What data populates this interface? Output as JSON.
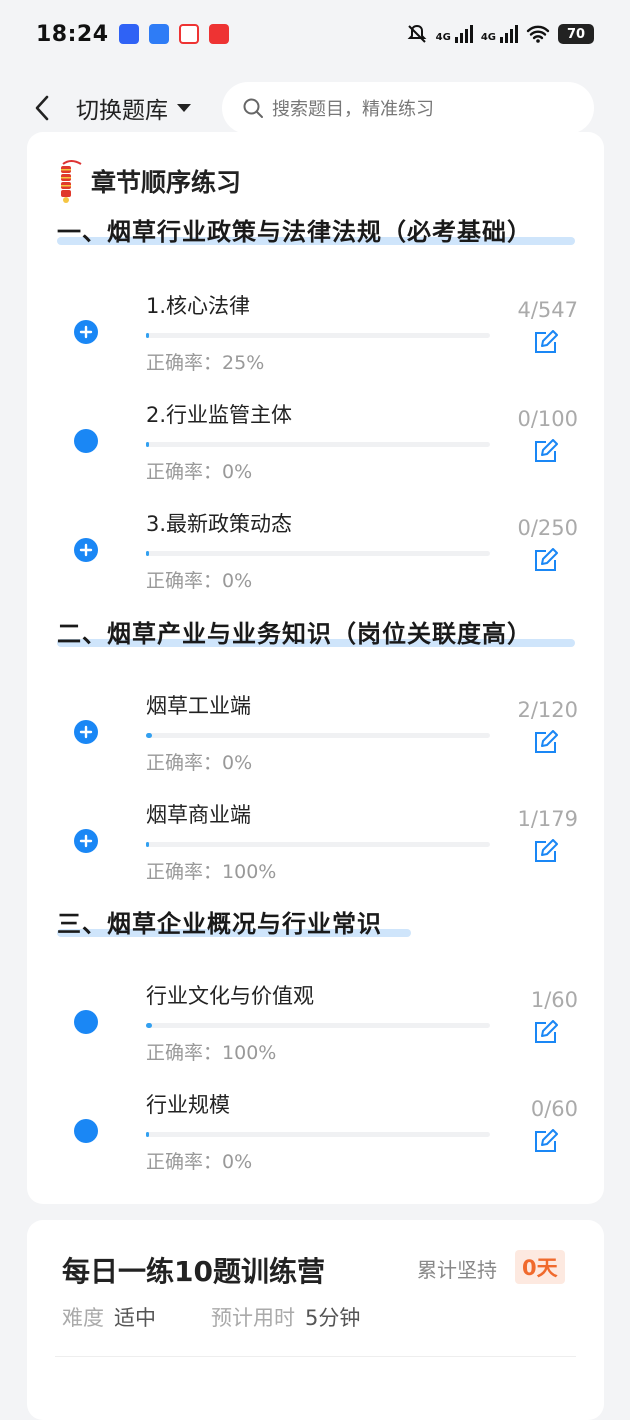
{
  "status_bar": {
    "time": "18:24",
    "signal1": "4G",
    "signal2": "4G",
    "battery": "70"
  },
  "nav": {
    "switch_label": "切换题库",
    "search_placeholder": "搜索题目，精准练习"
  },
  "main_card": {
    "title": "章节顺序练习",
    "accuracy_label": "正确率：",
    "sections": [
      {
        "title": "一、烟草行业政策与法律法规（必考基础）",
        "items": [
          {
            "name": "1.核心法律",
            "accuracy": "25%",
            "count": "4/547",
            "progress": 0.0073,
            "icon": "plus-circle-icon"
          },
          {
            "name": "2.行业监管主体",
            "accuracy": "0%",
            "count": "0/100",
            "progress": 0,
            "icon": "dot-icon"
          },
          {
            "name": "3.最新政策动态",
            "accuracy": "0%",
            "count": "0/250",
            "progress": 0,
            "icon": "plus-circle-icon"
          }
        ]
      },
      {
        "title": "二、烟草产业与业务知识（岗位关联度高）",
        "items": [
          {
            "name": "烟草工业端",
            "accuracy": "0%",
            "count": "2/120",
            "progress": 0.0167,
            "icon": "plus-circle-icon"
          },
          {
            "name": "烟草商业端",
            "accuracy": "100%",
            "count": "1/179",
            "progress": 0.0056,
            "icon": "plus-circle-icon"
          }
        ]
      },
      {
        "title": "三、烟草企业概况与行业常识",
        "items": [
          {
            "name": "行业文化与价值观",
            "accuracy": "100%",
            "count": "1/60",
            "progress": 0.0167,
            "icon": "dot-icon"
          },
          {
            "name": "行业规模",
            "accuracy": "0%",
            "count": "0/60",
            "progress": 0,
            "icon": "dot-icon"
          }
        ]
      }
    ]
  },
  "daily_card": {
    "title": "每日一练10题训练营",
    "streak_label": "累计坚持",
    "streak_value": "0天",
    "difficulty_label": "难度",
    "difficulty_value": "适中",
    "time_label": "预计用时",
    "time_value": "5分钟"
  },
  "colors": {
    "accent": "#1a87f5",
    "streak": "#f06a2d"
  }
}
